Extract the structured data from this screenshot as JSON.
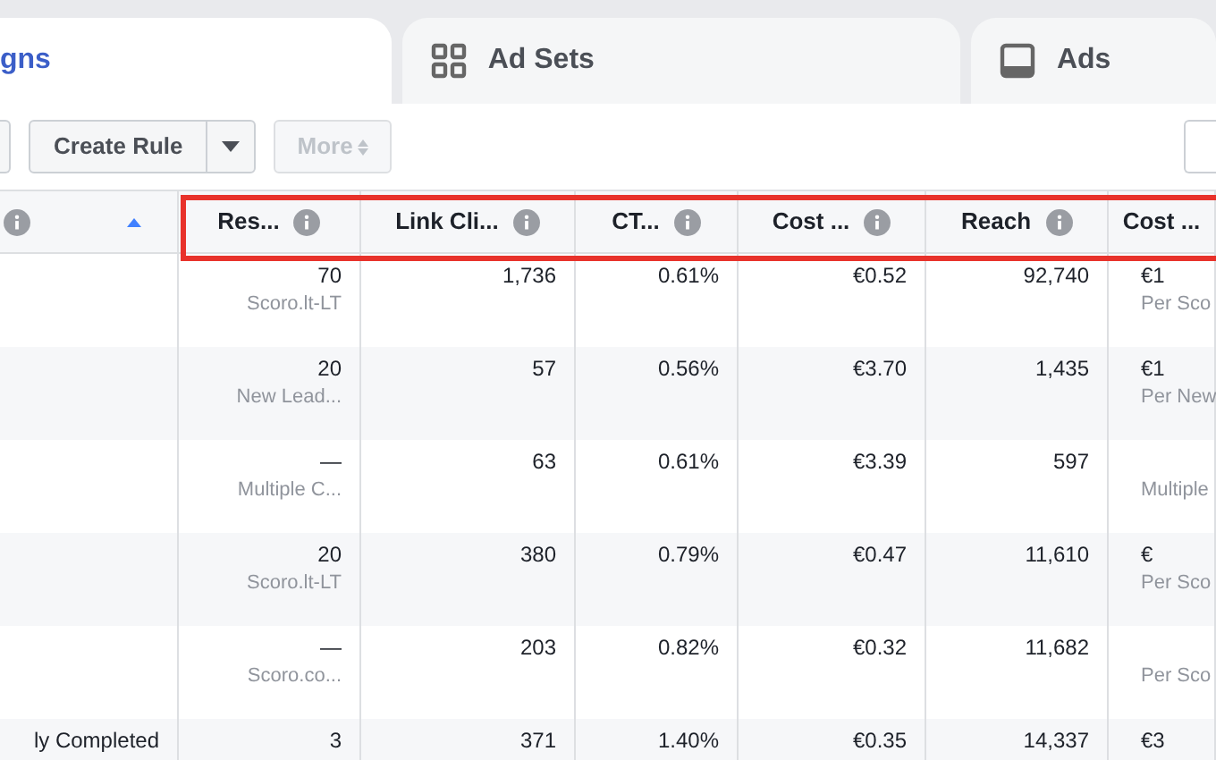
{
  "tabs": [
    {
      "label": "gns",
      "selected": true
    },
    {
      "label": "Ad Sets",
      "selected": false
    },
    {
      "label": "Ads",
      "selected": false
    }
  ],
  "toolbar": {
    "create_rule": "Create Rule",
    "more": {
      "label": "More",
      "disabled": true
    }
  },
  "table": {
    "columns": [
      {
        "info": true,
        "sorted": true
      },
      {
        "label": "Res...",
        "info": true,
        "sorted": false
      },
      {
        "label": "Link Cli...",
        "info": true,
        "sorted": false
      },
      {
        "label": "CT...",
        "info": true,
        "sorted": false
      },
      {
        "label": "Cost ...",
        "info": true,
        "sorted": false
      },
      {
        "label": "Reach",
        "info": true,
        "sorted": false
      },
      {
        "label": "Cost ...",
        "info": false,
        "sorted": false
      }
    ],
    "highlighted": true,
    "rows": [
      [
        {},
        {
          "value": "70",
          "sub": "Scoro.lt-LT"
        },
        {
          "value": "1,736"
        },
        {
          "value": "0.61%"
        },
        {
          "value": "€0.52"
        },
        {
          "value": "92,740"
        },
        {
          "value": "€1",
          "sub": "Per Sco"
        }
      ],
      [
        {},
        {
          "value": "20",
          "sub": "New Lead..."
        },
        {
          "value": "57"
        },
        {
          "value": "0.56%"
        },
        {
          "value": "€3.70"
        },
        {
          "value": "1,435"
        },
        {
          "value": "€1",
          "sub": "Per New"
        }
      ],
      [
        {},
        {
          "value": "—",
          "sub": "Multiple C..."
        },
        {
          "value": "63"
        },
        {
          "value": "0.61%"
        },
        {
          "value": "€3.39"
        },
        {
          "value": "597"
        },
        {
          "sub": "Multiple"
        }
      ],
      [
        {},
        {
          "value": "20",
          "sub": "Scoro.lt-LT"
        },
        {
          "value": "380"
        },
        {
          "value": "0.79%"
        },
        {
          "value": "€0.47"
        },
        {
          "value": "11,610"
        },
        {
          "value": "€",
          "sub": "Per Sco"
        }
      ],
      [
        {},
        {
          "value": "—",
          "sub": "Scoro.co..."
        },
        {
          "value": "203"
        },
        {
          "value": "0.82%"
        },
        {
          "value": "€0.32"
        },
        {
          "value": "11,682"
        },
        {
          "sub": "Per Sco"
        }
      ],
      [
        {
          "value": "ly Completed"
        },
        {
          "value": "3"
        },
        {
          "value": "371"
        },
        {
          "value": "1.40%"
        },
        {
          "value": "€0.35"
        },
        {
          "value": "14,337"
        },
        {
          "value": "€3"
        }
      ]
    ]
  }
}
